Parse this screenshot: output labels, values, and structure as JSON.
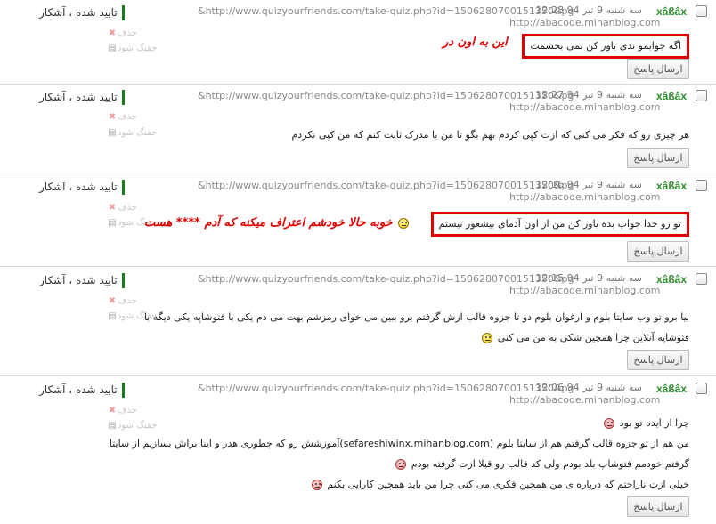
{
  "common": {
    "author": "xâßâx",
    "status": "تایید شده ، آشکار",
    "delete": "حذف",
    "spam": "جفنگ شود",
    "reply": "ارسال پاسخ",
    "ref_line1": "&http://www.quizyourfriends.com/take-quiz.php?id=1506280700151350&pg",
    "ref_line2": "http://abacode.mihanblog.com"
  },
  "comments": [
    {
      "date": "سه شنبه 9 تیر 94  12:28",
      "lines": [
        "اگه جوابمو ندی باور کن نمی بخشمت"
      ],
      "note": "این به اون در"
    },
    {
      "date": "سه شنبه 9 تیر 94  12:27",
      "lines": [
        "هر چیزی رو که فکر می کنی که ازت کپی کردم بهم بگو تا من با مدرک ثابت کنم که من کپی نکردم"
      ]
    },
    {
      "date": "سه شنبه 9 تیر 94  12:16",
      "lines": [
        "تو رو خدا جواب بده باور کن من از اون آدمای بیشعور نیستم"
      ],
      "note": "خوبه حالا خودشم اعتراف میکنه که آدم **** هست"
    },
    {
      "date": "سه شنبه 9 تیر 94  12:15",
      "lines": [
        "بیا برو تو وب سایتا بلوم و ارغوان بلوم دو تا جزوه قالب ازش گرفتم برو ببین می خوای رمزشم بهت می دم یکی با فتوشاپه یکی دیگه با",
        "فتوشاپه آنلاین چرا همچین شکی به من می کنی"
      ]
    },
    {
      "date": "سه شنبه 9 تیر 94  12:06",
      "lines": [
        "چرا از ایده تو بود",
        "من هم از تو جزوه قالب گرفتم هم از سایتا بلوم (sefareshiwinx.mihanblog.com)آموزشش رو که چطوری هدر و اینا براش بسازیم از سایتا",
        "گرفتم خودمم فتوشاپ بلد بودم ولی کد قالب رو قبلا ازت گرفته بودم",
        "خیلی ازت ناراحتم که درباره ی من همچین فکری می کنی چرا من باید همچین کارایی بکنم"
      ]
    }
  ]
}
